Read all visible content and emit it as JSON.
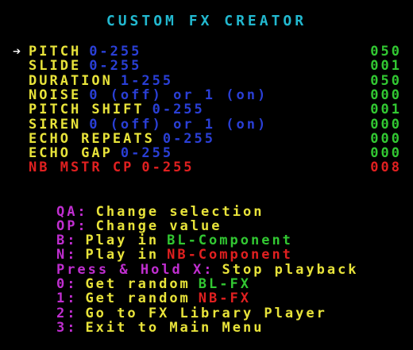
{
  "colors": {
    "background": "#000000",
    "title": "#22b8cf",
    "param_name": "#e8e33a",
    "param_range": "#2a3fd6",
    "param_value": "#32c832",
    "selected_param": "#e02020",
    "selected_value": "#e02020",
    "cursor": "#ffffff",
    "key": "#c02ed0",
    "help_text": "#e8e33a",
    "bl": "#32c832",
    "nb": "#e02020"
  },
  "title": "CUSTOM FX CREATOR",
  "cursor_glyph": "➔",
  "params": [
    {
      "name": "PITCH",
      "range": "0-255",
      "value": "050"
    },
    {
      "name": "SLIDE",
      "range": "0-255",
      "value": "001"
    },
    {
      "name": "DURATION",
      "range": "1-255",
      "value": "050"
    },
    {
      "name": "NOISE",
      "range": "0 (off) or 1 (on)",
      "value": "000"
    },
    {
      "name": "PITCH SHIFT",
      "range": "0-255",
      "value": "001"
    },
    {
      "name": "SIREN",
      "range": "0 (off) or 1 (on)",
      "value": "000"
    },
    {
      "name": "ECHO REPEATS",
      "range": "0-255",
      "value": "000"
    },
    {
      "name": "ECHO GAP",
      "range": "0-255",
      "value": "000"
    },
    {
      "name": "NB MSTR CP",
      "range": "0-255",
      "value": "008"
    }
  ],
  "help": {
    "qa_key": "QA:",
    "qa_text": "Change selection",
    "op_key": "OP:",
    "op_text": "Change value",
    "b_key": "B:",
    "b_text": "Play in",
    "b_target": "BL-Component",
    "n_key": "N:",
    "n_text": "Play in",
    "n_target": "NB-Component",
    "x_key": "Press & Hold X:",
    "x_text": "Stop playback",
    "k0_key": "0:",
    "k0_text": "Get random",
    "k0_target": "BL-FX",
    "k1_key": "1:",
    "k1_text": "Get random",
    "k1_target": "NB-FX",
    "k2_key": "2:",
    "k2_text": "Go to FX Library Player",
    "k3_key": "3:",
    "k3_text": "Exit to Main Menu"
  }
}
